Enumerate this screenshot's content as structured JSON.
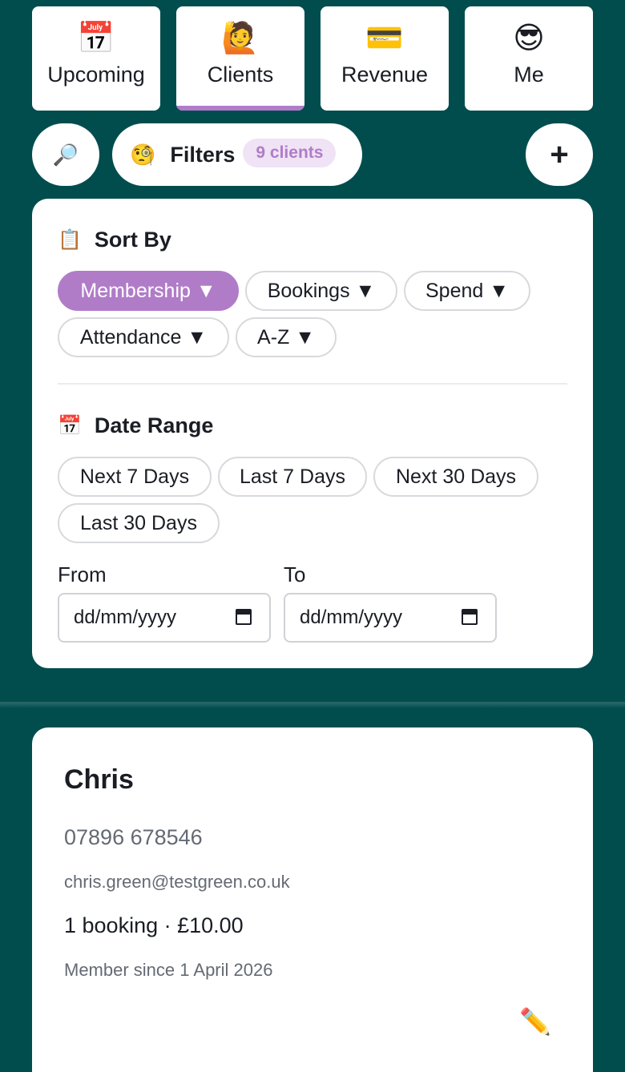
{
  "nav": {
    "tabs": [
      {
        "label": "Upcoming",
        "icon": "📅"
      },
      {
        "label": "Clients",
        "icon": "🙋"
      },
      {
        "label": "Revenue",
        "icon": "💳"
      },
      {
        "label": "Me",
        "icon": "😎"
      }
    ],
    "active_tab": "Clients",
    "accent_color": "#b07cc8"
  },
  "toolbar": {
    "search_icon": "🔎",
    "filters_icon": "🧐",
    "filters_label": "Filters",
    "client_count_badge": "9 clients",
    "add_icon": "+"
  },
  "filters": {
    "sort_by": {
      "icon": "📋",
      "title": "Sort By",
      "options": [
        "Membership ▼",
        "Bookings ▼",
        "Spend ▼",
        "Attendance ▼",
        "A-Z ▼"
      ],
      "selected": "Membership ▼"
    },
    "date_range": {
      "icon": "📅",
      "title": "Date Range",
      "presets": [
        "Next 7 Days",
        "Last 7 Days",
        "Next 30 Days",
        "Last 30 Days"
      ],
      "from_label": "From",
      "to_label": "To",
      "from_placeholder": "dd/mm/yyyy",
      "to_placeholder": "dd/mm/yyyy"
    }
  },
  "clients": [
    {
      "name": "Chris",
      "phone": "07896 678546",
      "email": "chris.green@testgreen.co.uk",
      "bookings_summary": "1 booking · £10.00",
      "member_since": "Member since 1 April 2026",
      "edit_icon": "✏️"
    }
  ],
  "colors": {
    "background": "#014d4e",
    "accent": "#b07cc8",
    "badge_bg": "#efe3f5"
  }
}
